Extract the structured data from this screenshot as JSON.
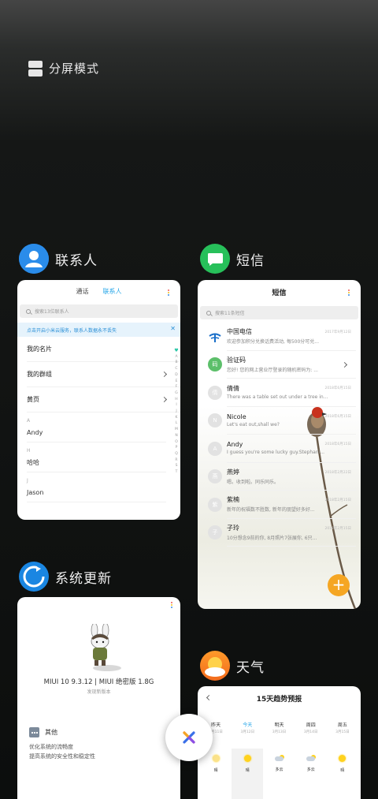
{
  "split_screen": {
    "label": "分屏模式"
  },
  "apps": {
    "contacts": {
      "name": "联系人",
      "tabs": [
        "通话",
        "联系人"
      ],
      "active_tab": "联系人",
      "search_placeholder": "搜索13位联系人",
      "banner": "点击开启小米云服务，联系人数据永不丢失",
      "rows": [
        {
          "label": "我的名片",
          "chevron": false
        },
        {
          "label": "我的群组",
          "chevron": true
        },
        {
          "label": "黄页",
          "chevron": true
        }
      ],
      "sections": [
        {
          "letter": "A",
          "name": "Andy"
        },
        {
          "letter": "H",
          "name": "哈哈"
        },
        {
          "letter": "J",
          "name": "Jason"
        }
      ],
      "alpha_index": [
        "A",
        "B",
        "C",
        "D",
        "E",
        "F",
        "G",
        "H",
        "I",
        "J",
        "K",
        "L",
        "M",
        "N",
        "O",
        "P",
        "Q",
        "R",
        "S",
        "T"
      ]
    },
    "messages": {
      "name": "短信",
      "title": "短信",
      "search_placeholder": "搜索11条短信",
      "threads": [
        {
          "sender": "中国电信",
          "preview": "欢迎参加积分兑换话费活动, 每500分可兑...",
          "date": "2017年9月12日",
          "avatar": "telecom"
        },
        {
          "sender": "验证码",
          "preview": "您好! 您的网上营业厅登录的随机密码为: ...",
          "date": "",
          "avatar": "码"
        },
        {
          "sender": "倩倩",
          "preview": "There was a table set out under a tree in...",
          "date": "2018年6月15日",
          "avatar": "倩"
        },
        {
          "sender": "Nicole",
          "preview": "Let's eat out,shall we?",
          "date": "2018年6月15日",
          "avatar": "N"
        },
        {
          "sender": "Andy",
          "preview": "I guess you're some lucky guy.Stephani...",
          "date": "2018年6月15日",
          "avatar": "A"
        },
        {
          "sender": "燕婷",
          "preview": "嗯。收到啦。同乐同乐。",
          "date": "2018年2月22日",
          "avatar": "燕"
        },
        {
          "sender": "紫楠",
          "preview": "新年的祝福数不胜数, 新年的朋望好多好...",
          "date": "2018年2月15日",
          "avatar": "紫"
        },
        {
          "sender": "子玲",
          "preview": "10分想念9前的你, 8月照片7张展你, 6只...",
          "date": "2018年2月15日",
          "avatar": "子"
        }
      ]
    },
    "update": {
      "name": "系统更新",
      "version": "MIUI 10 9.3.12 | MIUI 绝密版 1.8G",
      "subtitle": "发现新版本",
      "other_label": "其他",
      "notes": [
        "优化系统的流畅度",
        "提高系统的安全性和稳定性"
      ]
    },
    "weather": {
      "name": "天气",
      "title": "15天趋势预报",
      "days": [
        {
          "day": "昨天",
          "date": "3月11日",
          "condition": "晴",
          "icon": "sun-pale"
        },
        {
          "day": "今天",
          "date": "3月12日",
          "condition": "晴",
          "icon": "sun"
        },
        {
          "day": "明天",
          "date": "3月13日",
          "condition": "多云",
          "icon": "cloudy"
        },
        {
          "day": "周四",
          "date": "3月14日",
          "condition": "多云",
          "icon": "cloudy"
        },
        {
          "day": "周五",
          "date": "3月15日",
          "condition": "晴",
          "icon": "sun"
        }
      ]
    }
  },
  "colors": {
    "contacts_icon": "#1e7fe0",
    "messages_icon": "#27c05a",
    "update_icon": "#1a86e2",
    "weather_icon": "#f5a623",
    "accent": "#26a6e8",
    "fab": "#f5a623"
  }
}
